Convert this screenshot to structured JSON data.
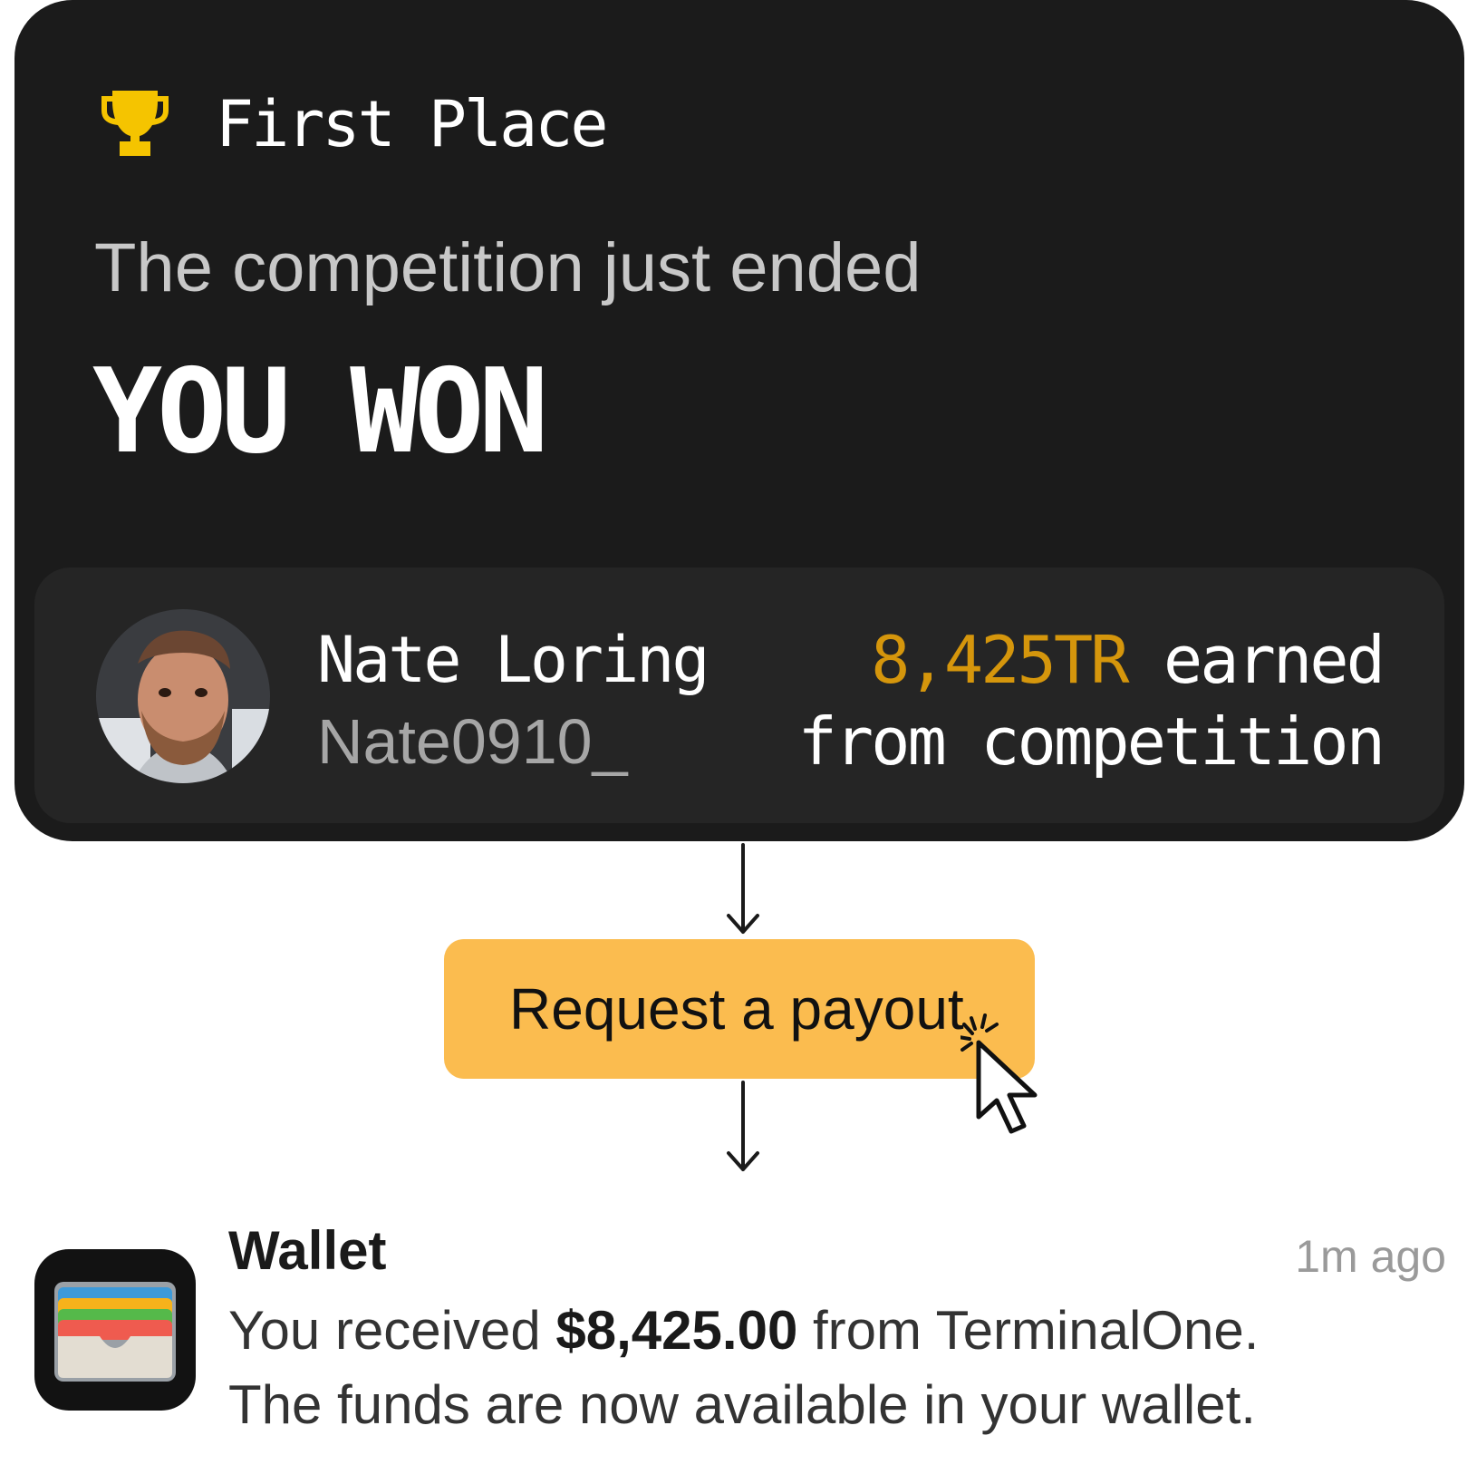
{
  "card": {
    "badge_label": "First Place",
    "subtitle": "The competition just ended",
    "headline": "YOU WON",
    "user": {
      "name": "Nate Loring",
      "handle": "Nate0910_"
    },
    "earnings": {
      "amount": "8,425TR",
      "suffix": " earned",
      "line2": "from competition"
    }
  },
  "payout_button": {
    "label": "Request a payout"
  },
  "notification": {
    "app": "Wallet",
    "time": "1m ago",
    "prefix": "You received ",
    "amount": "$8,425.00",
    "suffix": " from TerminalOne.",
    "line2": "The funds are now available in your wallet."
  },
  "colors": {
    "card_bg": "#1b1b1b",
    "panel_bg": "#252525",
    "accent_gold": "#d5960c",
    "trophy": "#f5c400",
    "button_bg": "#fbbc4f"
  },
  "icons": [
    "trophy-icon",
    "avatar",
    "arrow-down-icon",
    "cursor-click-icon",
    "wallet-app-icon"
  ]
}
